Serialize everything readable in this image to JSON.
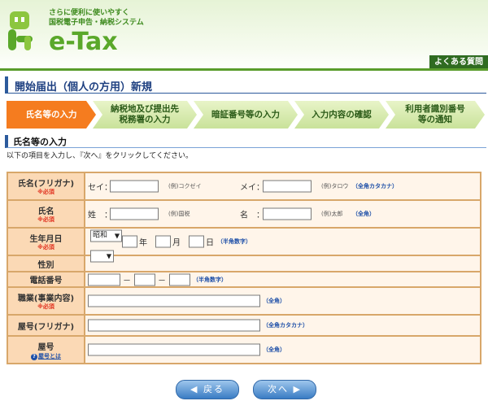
{
  "header": {
    "tagline1": "さらに便利に使いやすく",
    "tagline2": "国税電子申告・納税システム",
    "brand": "e-Tax",
    "faq": "よくある質問"
  },
  "page_title": "開始届出（個人の方用）新規",
  "steps": [
    {
      "line1": "氏名等の入力",
      "line2": ""
    },
    {
      "line1": "納税地及び提出先",
      "line2": "税務署の入力"
    },
    {
      "line1": "暗証番号等の入力",
      "line2": ""
    },
    {
      "line1": "入力内容の確認",
      "line2": ""
    },
    {
      "line1": "利用者識別番号",
      "line2": "等の通知"
    }
  ],
  "section_title": "氏名等の入力",
  "instruction": "以下の項目を入力し、『次へ』をクリックしてください。",
  "required_mark": "※必須",
  "form": {
    "kana": {
      "label": "氏名(フリガナ)",
      "sei": "セイ：",
      "sei_ex": "(例)コクゼイ",
      "mei": "メイ：",
      "mei_ex": "(例)タロウ",
      "hint": "（全角カタカナ）"
    },
    "name": {
      "label": "氏名",
      "sei": "姓　：",
      "sei_ex": "(例)国税",
      "mei": "名　：",
      "mei_ex": "(例)太郎",
      "hint": "（全角）"
    },
    "birth": {
      "label": "生年月日",
      "era": "昭和",
      "year": "年",
      "month": "月",
      "day": "日",
      "hint": "（半角数字）"
    },
    "gender": {
      "label": "性別",
      "value": ""
    },
    "phone": {
      "label": "電話番号",
      "dash": "－",
      "hint": "（半角数字）"
    },
    "job": {
      "label": "職業(事業内容)",
      "hint": "（全角）"
    },
    "yago_kana": {
      "label": "屋号(フリガナ)",
      "hint": "（全角カタカナ）"
    },
    "yago": {
      "label": "屋号",
      "help": "屋号とは",
      "hint": "（全角）"
    }
  },
  "buttons": {
    "back": "戻る",
    "next": "次へ"
  },
  "colors": {
    "active_step": "#f57c1f",
    "label_bg": "#fbd9b5",
    "field_bg": "#fff5ea",
    "border": "#d8a76a",
    "required": "#e0301e"
  }
}
